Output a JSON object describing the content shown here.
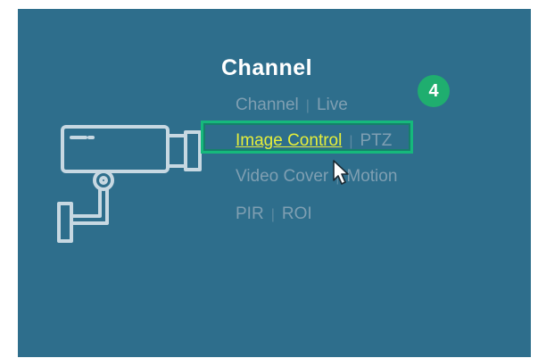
{
  "section": {
    "title": "Channel"
  },
  "menu": {
    "row1": [
      "Channel",
      "Live"
    ],
    "row2": [
      "Image Control",
      "PTZ"
    ],
    "row3": [
      "Video Cover",
      "Motion"
    ],
    "row4": [
      "PIR",
      "ROI"
    ],
    "selected": "Image Control"
  },
  "annotation": {
    "step_number": "4",
    "badge_color": "#1fae6f",
    "highlight_color": "#16b87c"
  },
  "colors": {
    "background": "#2e6e8c",
    "active_text": "#e6ef3a",
    "inactive_text": "#7f9fb2"
  },
  "icons": {
    "camera": "security-camera-icon",
    "cursor": "mouse-pointer-icon"
  }
}
